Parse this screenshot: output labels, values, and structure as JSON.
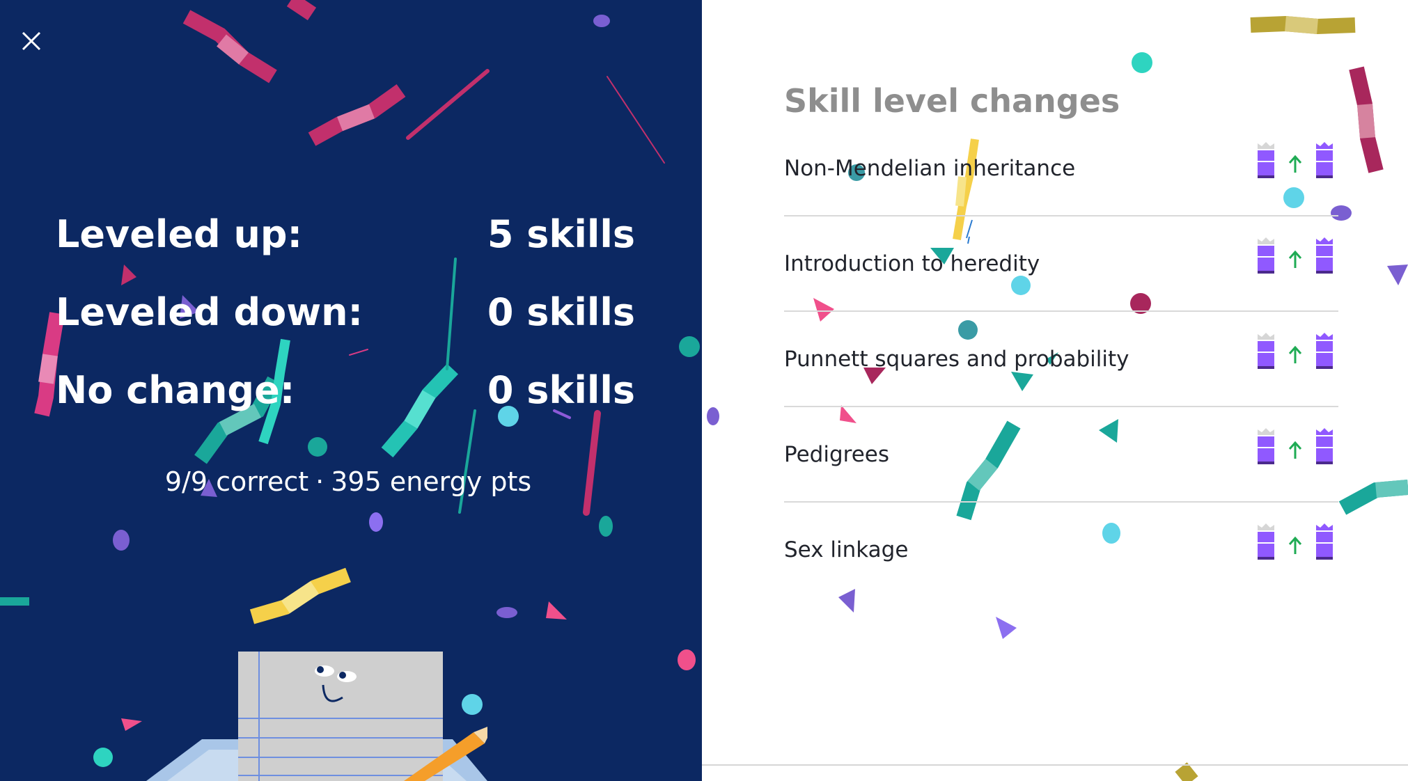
{
  "close_button": {
    "icon": "close-icon",
    "label": "Close"
  },
  "summary": {
    "stats": [
      {
        "label": "Leveled up:",
        "value": "5 skills"
      },
      {
        "label": "Leveled down:",
        "value": "0 skills"
      },
      {
        "label": "No change:",
        "value": "0 skills"
      }
    ],
    "correct": "9/9 correct",
    "separator": "·",
    "energy": "395 energy pts"
  },
  "skill_changes": {
    "title": "Skill level changes",
    "skills": [
      {
        "name": "Non-Mendelian inheritance",
        "from_icon": "mastery-level-icon",
        "arrow": "arrow-up-icon",
        "to_icon": "mastery-crown-icon"
      },
      {
        "name": "Introduction to heredity",
        "from_icon": "mastery-level-icon",
        "arrow": "arrow-up-icon",
        "to_icon": "mastery-crown-icon"
      },
      {
        "name": "Punnett squares and probability",
        "from_icon": "mastery-level-icon",
        "arrow": "arrow-up-icon",
        "to_icon": "mastery-crown-icon"
      },
      {
        "name": "Pedigrees",
        "from_icon": "mastery-level-icon",
        "arrow": "arrow-up-icon",
        "to_icon": "mastery-crown-icon"
      },
      {
        "name": "Sex linkage",
        "from_icon": "mastery-level-icon",
        "arrow": "arrow-up-icon",
        "to_icon": "mastery-crown-icon"
      }
    ]
  },
  "colors": {
    "left_background": "#0c2862",
    "mastery_purple": "#9059ff",
    "arrow_green": "#1fab54",
    "title_gray": "#8e8e8e"
  }
}
